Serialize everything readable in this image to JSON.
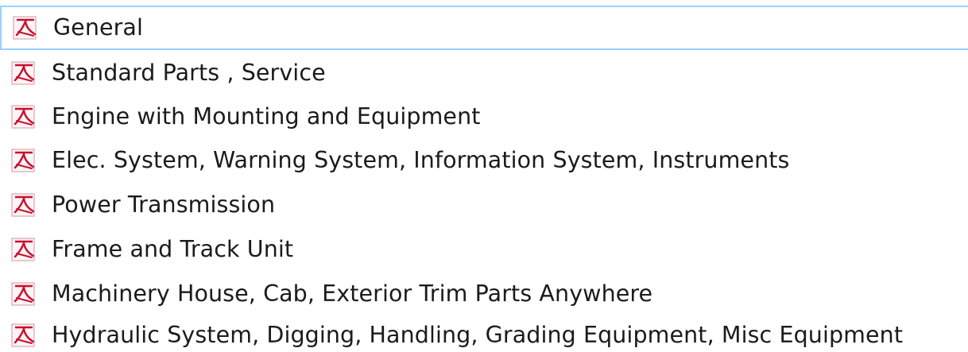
{
  "file_list": {
    "icon": "pdf-icon",
    "accent_color": "#c8102e",
    "selection_border_color": "#99d1ff",
    "items": [
      {
        "label": "General",
        "selected": true
      },
      {
        "label": "Standard Parts , Service",
        "selected": false
      },
      {
        "label": "Engine with Mounting and Equipment",
        "selected": false
      },
      {
        "label": "Elec. System, Warning System, Information System, Instruments",
        "selected": false
      },
      {
        "label": "Power Transmission",
        "selected": false
      },
      {
        "label": "Frame and Track Unit",
        "selected": false
      },
      {
        "label": "Machinery House, Cab, Exterior Trim Parts Anywhere",
        "selected": false
      },
      {
        "label": "Hydraulic System, Digging, Handling, Grading Equipment, Misc Equipment",
        "selected": false
      }
    ]
  }
}
